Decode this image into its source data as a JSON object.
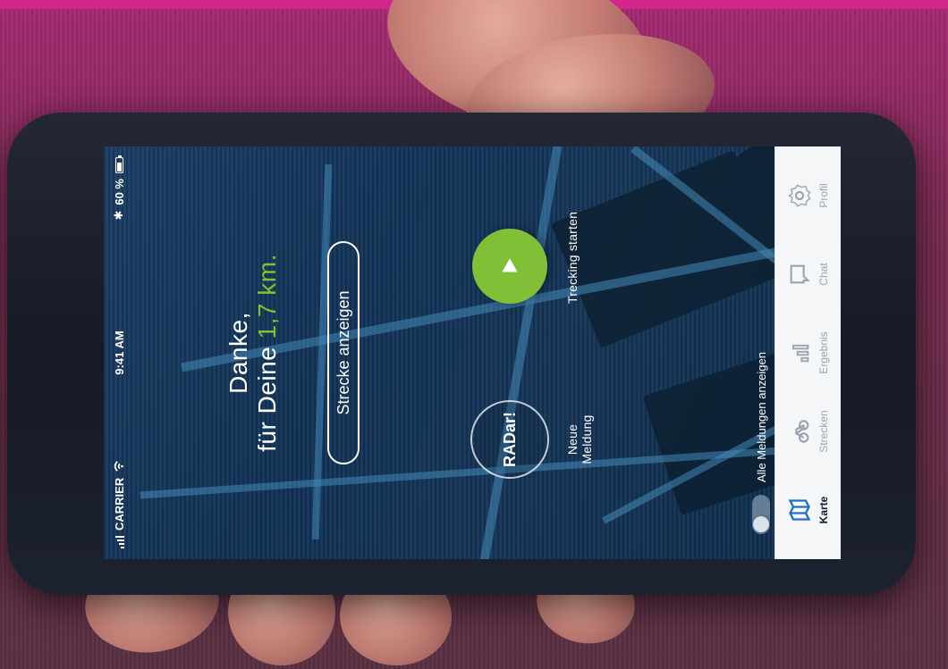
{
  "status_bar": {
    "carrier": "CARRIER",
    "time": "9:41 AM",
    "battery": "60 %"
  },
  "main": {
    "thanks_line_1": "Danke,",
    "thanks_line_2_prefix": "für Deine ",
    "distance": "1,7 km",
    "distance_suffix": ".",
    "show_route_label": "Strecke anzeigen",
    "radar_label": "RADar!",
    "new_report_label": "Neue Meldung",
    "start_tracking_label": "Trecking starten",
    "show_all_reports_label": "Alle Meldungen anzeigen"
  },
  "nav": {
    "items": [
      {
        "label": "Karte",
        "icon": "map-icon",
        "active": true
      },
      {
        "label": "Strecken",
        "icon": "bike-icon",
        "active": false
      },
      {
        "label": "Ergebnis",
        "icon": "bar-chart-icon",
        "active": false
      },
      {
        "label": "Chat",
        "icon": "chat-icon",
        "active": false
      },
      {
        "label": "Profil",
        "icon": "settings-icon",
        "active": false
      }
    ]
  },
  "colors": {
    "accent_green": "#85bf2e",
    "brand_magenta": "#d3268c",
    "map_blue": "#123356",
    "nav_background": "#f4f6f8"
  }
}
